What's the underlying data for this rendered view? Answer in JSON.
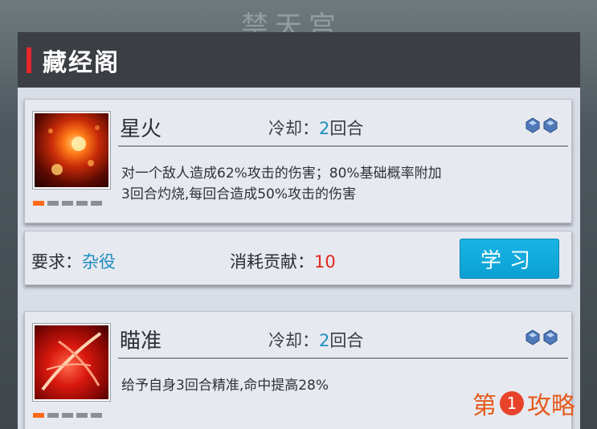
{
  "background_title": "禁天宫",
  "panel": {
    "title": "藏经阁"
  },
  "skills": [
    {
      "name": "星火",
      "cooldown_label": "冷却：",
      "cooldown_value": "2",
      "cooldown_unit": "回合",
      "description_line1": "对一个敌人造成62%攻击的伤害；80%基础概率附加",
      "description_line2": "3回合灼烧,每回合造成50%攻击的伤害",
      "icon": "fire-skill-icon",
      "level_filled": 1,
      "level_total": 5
    },
    {
      "name": "瞄准",
      "cooldown_label": "冷却：",
      "cooldown_value": "2",
      "cooldown_unit": "回合",
      "description_line1": "给予自身3回合精准,命中提高28%",
      "icon": "aim-skill-icon",
      "level_filled": 1,
      "level_total": 5
    }
  ],
  "requirement": {
    "req_label": "要求：",
    "req_value": "杂役",
    "cost_label": "消耗贡献：",
    "cost_value": "10",
    "learn_button": "学习"
  },
  "watermark": {
    "left": "第",
    "num": "1",
    "right": "攻略"
  },
  "colors": {
    "accent": "#e8272b",
    "link_blue": "#1f8fbf",
    "cost_red": "#e2261e",
    "button": "#0c9fd2"
  }
}
